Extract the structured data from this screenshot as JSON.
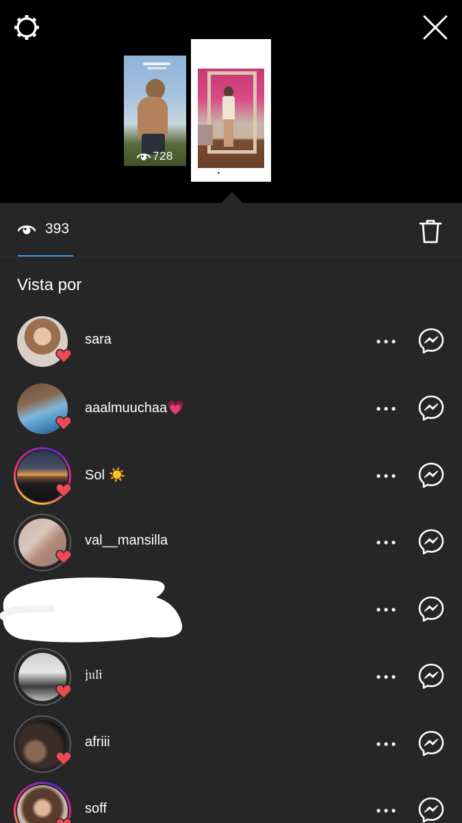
{
  "header": {
    "settings_icon": "gear-icon",
    "close_icon": "close-icon"
  },
  "stories": [
    {
      "views": "728"
    },
    {
      "views": "393"
    }
  ],
  "stats": {
    "view_count": "393",
    "delete_icon": "trash-icon"
  },
  "viewers": {
    "title": "Vista por",
    "items": [
      {
        "username": "sara",
        "liked": true
      },
      {
        "username": "aaalmuuchaa💗",
        "liked": true
      },
      {
        "username": "Sol ☀️",
        "liked": true
      },
      {
        "username": "val__mansilla",
        "liked": true
      },
      {
        "username": "",
        "liked": false
      },
      {
        "username": "𝔧𝔲𝔩𝔦",
        "liked": true
      },
      {
        "username": "afriii",
        "liked": true
      },
      {
        "username": "soff",
        "liked": true
      }
    ]
  },
  "colors": {
    "background": "#262626",
    "top_background": "#000000",
    "accent_blue": "#3897f0",
    "heart_red": "#ed4956"
  }
}
